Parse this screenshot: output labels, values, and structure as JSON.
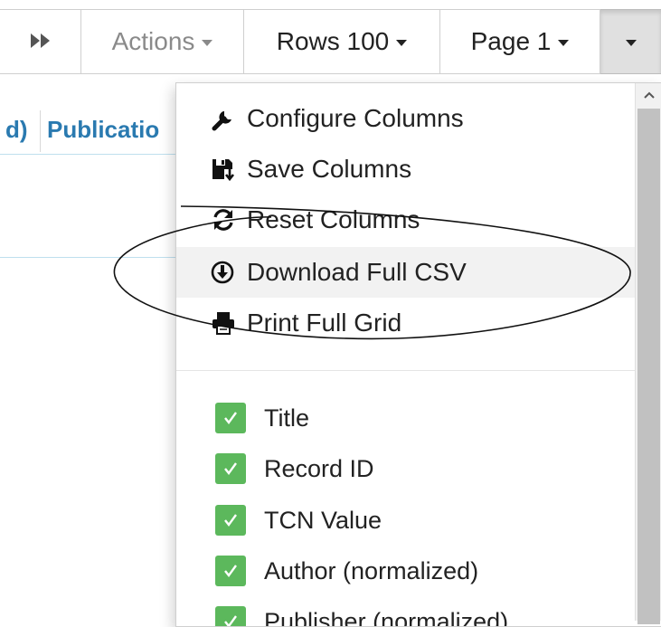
{
  "toolbar": {
    "forward_icon": "fast-forward-icon",
    "actions_label": "Actions",
    "rows_label": "Rows 100",
    "page_label": "Page 1",
    "menu_caret_icon": "caret-down-icon"
  },
  "grid": {
    "header_cells": [
      "d)",
      "Publicatio"
    ]
  },
  "menu": {
    "actions": [
      {
        "label": "Configure Columns",
        "icon": "wrench-icon"
      },
      {
        "label": "Save Columns",
        "icon": "save-icon"
      },
      {
        "label": "Reset Columns",
        "icon": "refresh-icon"
      },
      {
        "label": "Download Full CSV",
        "icon": "download-icon"
      },
      {
        "label": "Print Full Grid",
        "icon": "print-icon"
      }
    ],
    "columns": [
      {
        "label": "Title",
        "checked": true
      },
      {
        "label": "Record ID",
        "checked": true
      },
      {
        "label": "TCN Value",
        "checked": true
      },
      {
        "label": "Author (normalized)",
        "checked": true
      },
      {
        "label": "Publisher (normalized)",
        "checked": true
      }
    ]
  },
  "colors": {
    "check_green": "#5cb85c",
    "header_link_blue": "#2a7ab0"
  }
}
